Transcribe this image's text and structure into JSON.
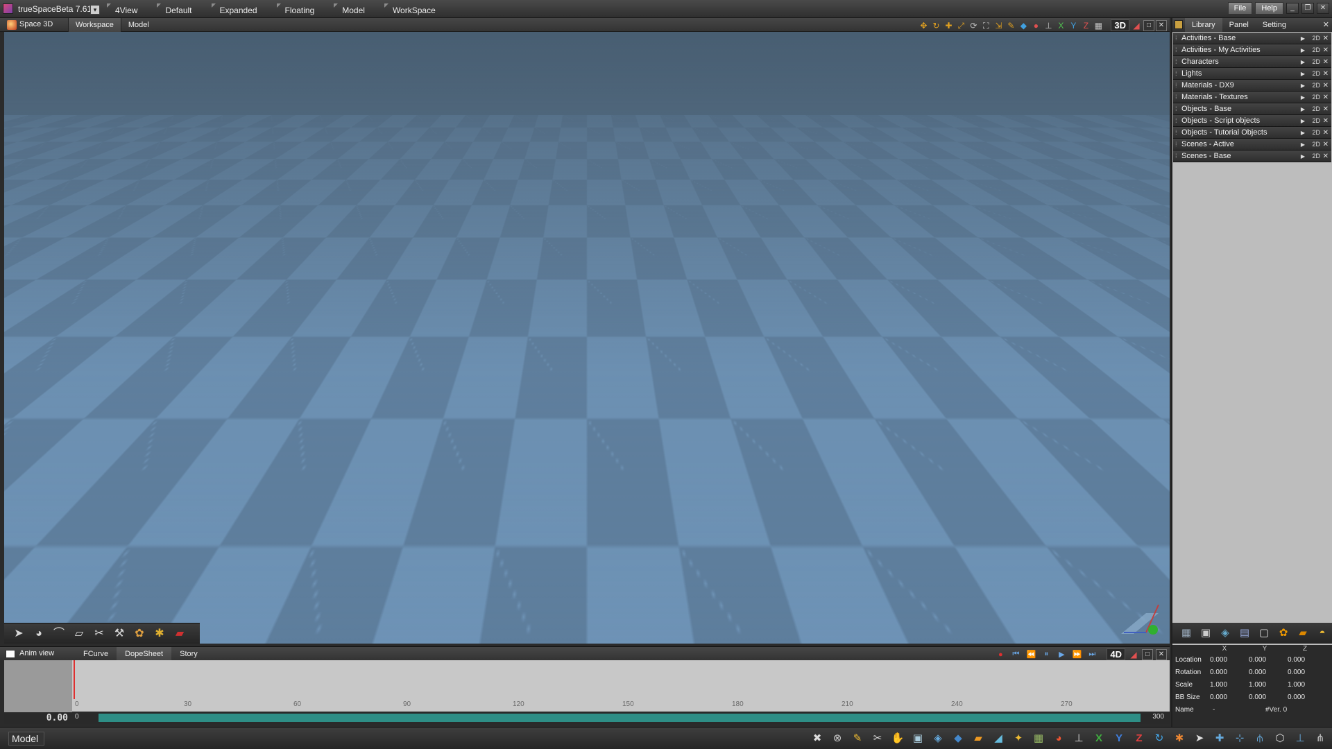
{
  "app": {
    "title": "trueSpaceBeta 7.61",
    "menu": [
      "4View",
      "Default",
      "Expanded",
      "Floating",
      "Model",
      "WorkSpace"
    ],
    "right_menu": [
      "File",
      "Help"
    ],
    "window_buttons": [
      "minimize-icon",
      "restore-icon",
      "close-icon"
    ]
  },
  "viewport": {
    "space_label": "Space 3D",
    "tabs": [
      "Workspace",
      "Model"
    ],
    "active_tab": "Workspace",
    "mode_label": "3D"
  },
  "library": {
    "tabs": [
      "Library",
      "Panel",
      "Setting"
    ],
    "active_tab": "Library",
    "items": [
      {
        "label": "Activities - Base",
        "badge": "2D"
      },
      {
        "label": "Activities - My Activities",
        "badge": "2D"
      },
      {
        "label": "Characters",
        "badge": "2D"
      },
      {
        "label": "Lights",
        "badge": "2D"
      },
      {
        "label": "Materials - DX9",
        "badge": "2D"
      },
      {
        "label": "Materials - Textures",
        "badge": "2D"
      },
      {
        "label": "Objects - Base",
        "badge": "2D"
      },
      {
        "label": "Objects - Script objects",
        "badge": "2D"
      },
      {
        "label": "Objects - Tutorial Objects",
        "badge": "2D"
      },
      {
        "label": "Scenes - Active",
        "badge": "2D"
      },
      {
        "label": "Scenes - Base",
        "badge": "2D"
      }
    ]
  },
  "transform": {
    "columns": [
      "X",
      "Y",
      "Z"
    ],
    "rows": [
      {
        "label": "Location",
        "values": [
          "0.000",
          "0.000",
          "0.000"
        ]
      },
      {
        "label": "Rotation",
        "values": [
          "0.000",
          "0.000",
          "0.000"
        ]
      },
      {
        "label": "Scale",
        "values": [
          "1.000",
          "1.000",
          "1.000"
        ]
      },
      {
        "label": "BB Size",
        "values": [
          "0.000",
          "0.000",
          "0.000"
        ]
      }
    ],
    "name_label": "Name",
    "name_value": "-",
    "version": "#Ver. 0"
  },
  "anim": {
    "title": "Anim view",
    "tabs": [
      "FCurve",
      "DopeSheet",
      "Story"
    ],
    "active_tab": "DopeSheet",
    "mode_label": "4D",
    "time": "0.00",
    "ticks": [
      "0",
      "30",
      "60",
      "90",
      "120",
      "150",
      "180",
      "210",
      "240",
      "270"
    ],
    "range_start": "0",
    "range_end": "300"
  },
  "status": {
    "mode": "Model"
  }
}
